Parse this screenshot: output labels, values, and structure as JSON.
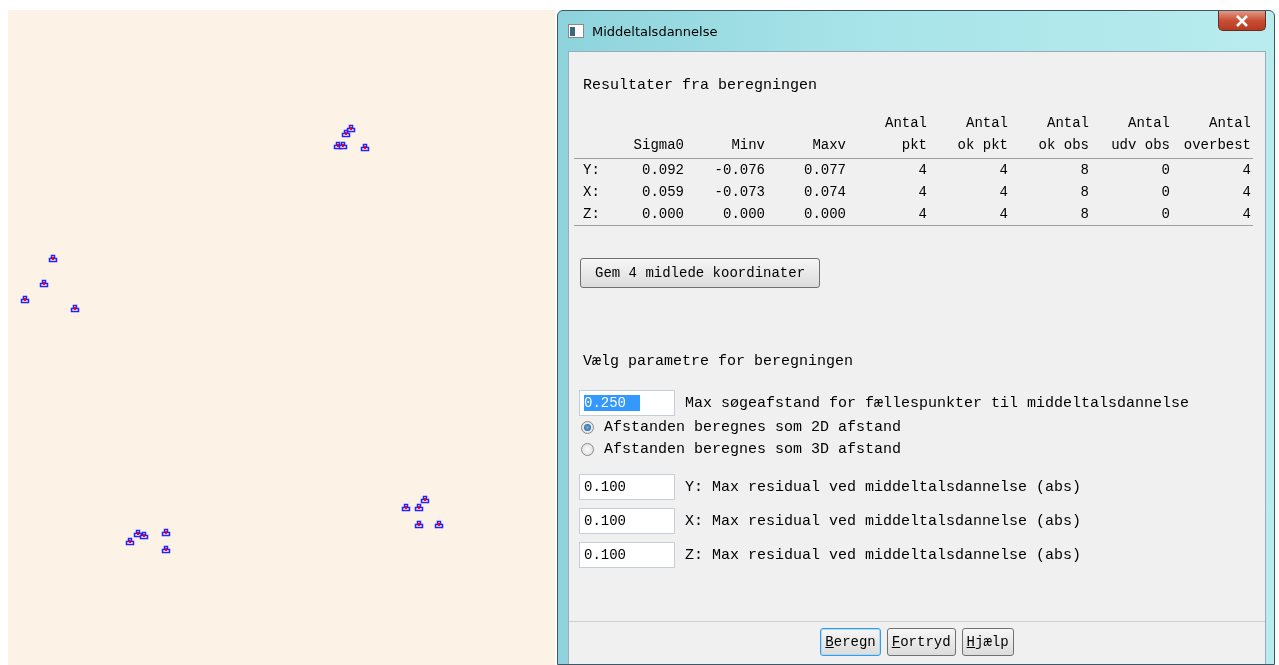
{
  "window": {
    "title": "Middeltalsdannelse"
  },
  "results": {
    "heading": "Resultater fra beregningen",
    "table": {
      "columns": [
        {
          "bottom": "Sigma0"
        },
        {
          "bottom": "Minv"
        },
        {
          "bottom": "Maxv"
        },
        {
          "top": "Antal",
          "bottom": "pkt"
        },
        {
          "top": "Antal",
          "bottom": "ok pkt"
        },
        {
          "top": "Antal",
          "bottom": "ok obs"
        },
        {
          "top": "Antal",
          "bottom": "udv obs"
        },
        {
          "top": "Antal",
          "bottom": "overbest"
        }
      ],
      "rows": [
        {
          "label": "Y:",
          "cells": [
            "0.092",
            "-0.076",
            "0.077",
            "4",
            "4",
            "8",
            "0",
            "4"
          ]
        },
        {
          "label": "X:",
          "cells": [
            "0.059",
            "-0.073",
            "0.074",
            "4",
            "4",
            "8",
            "0",
            "4"
          ]
        },
        {
          "label": "Z:",
          "cells": [
            "0.000",
            "0.000",
            "0.000",
            "4",
            "4",
            "8",
            "0",
            "4"
          ]
        }
      ]
    },
    "save_button": "Gem 4 midlede koordinater"
  },
  "parameters": {
    "heading": "Vælg parametre for beregningen",
    "search_distance": {
      "value": "0.250",
      "label": "Max søgeafstand for fællespunkter til middeltalsdannelse",
      "focused": true
    },
    "distance_mode": [
      {
        "label": "Afstanden beregnes som 2D afstand",
        "selected": true
      },
      {
        "label": "Afstanden beregnes som 3D afstand",
        "selected": false
      }
    ],
    "residuals": [
      {
        "value": "0.100",
        "label": "Y: Max residual ved middeltalsdannelse (abs)"
      },
      {
        "value": "0.100",
        "label": "X: Max residual ved middeltalsdannelse (abs)"
      },
      {
        "value": "0.100",
        "label": "Z: Max residual ved middeltalsdannelse (abs)"
      }
    ]
  },
  "buttons": [
    {
      "label": "Beregn",
      "default": true
    },
    {
      "label": "Fortryd",
      "default": false
    },
    {
      "label": "Hjælp",
      "default": false
    }
  ]
}
